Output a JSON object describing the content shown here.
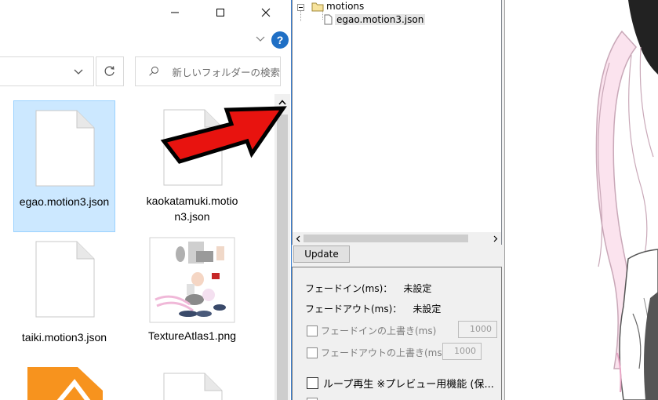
{
  "explorer": {
    "caption": {
      "minimize_icon": "minimize-icon",
      "maximize_icon": "maximize-icon",
      "close_icon": "close-icon"
    },
    "help_label": "?",
    "search": {
      "placeholder": "新しいフォルダーの検索"
    },
    "files": [
      {
        "name": "egao.motion3.json",
        "icon": "document-icon",
        "selected": true
      },
      {
        "name": "kaokatamuki.motion3.json",
        "icon": "document-icon",
        "selected": false
      },
      {
        "name": "taiki.motion3.json",
        "icon": "document-icon",
        "selected": false
      },
      {
        "name": "TextureAtlas1.png",
        "icon": "image-thumbnail",
        "selected": false
      }
    ],
    "accent_color": "#1f6fc5",
    "selection_color": "#cce8ff"
  },
  "viewer": {
    "tree": {
      "folder": "motions",
      "file": "egao.motion3.json"
    },
    "update_label": "Update",
    "settings": {
      "fade_in_label": "フェードイン(ms)：",
      "fade_in_value": "未設定",
      "fade_out_label": "フェードアウト(ms)：",
      "fade_out_value": "未設定",
      "override_fade_in_label": "フェードインの上書き(ms)",
      "override_fade_in_value": "1000",
      "override_fade_out_label": "フェードアウトの上書き(ms)",
      "override_fade_out_value": "1000",
      "loop_label": "ループ再生 ※プレビュー用機能 (保..."
    }
  },
  "annotation": {
    "arrow_color": "#e8130f"
  }
}
